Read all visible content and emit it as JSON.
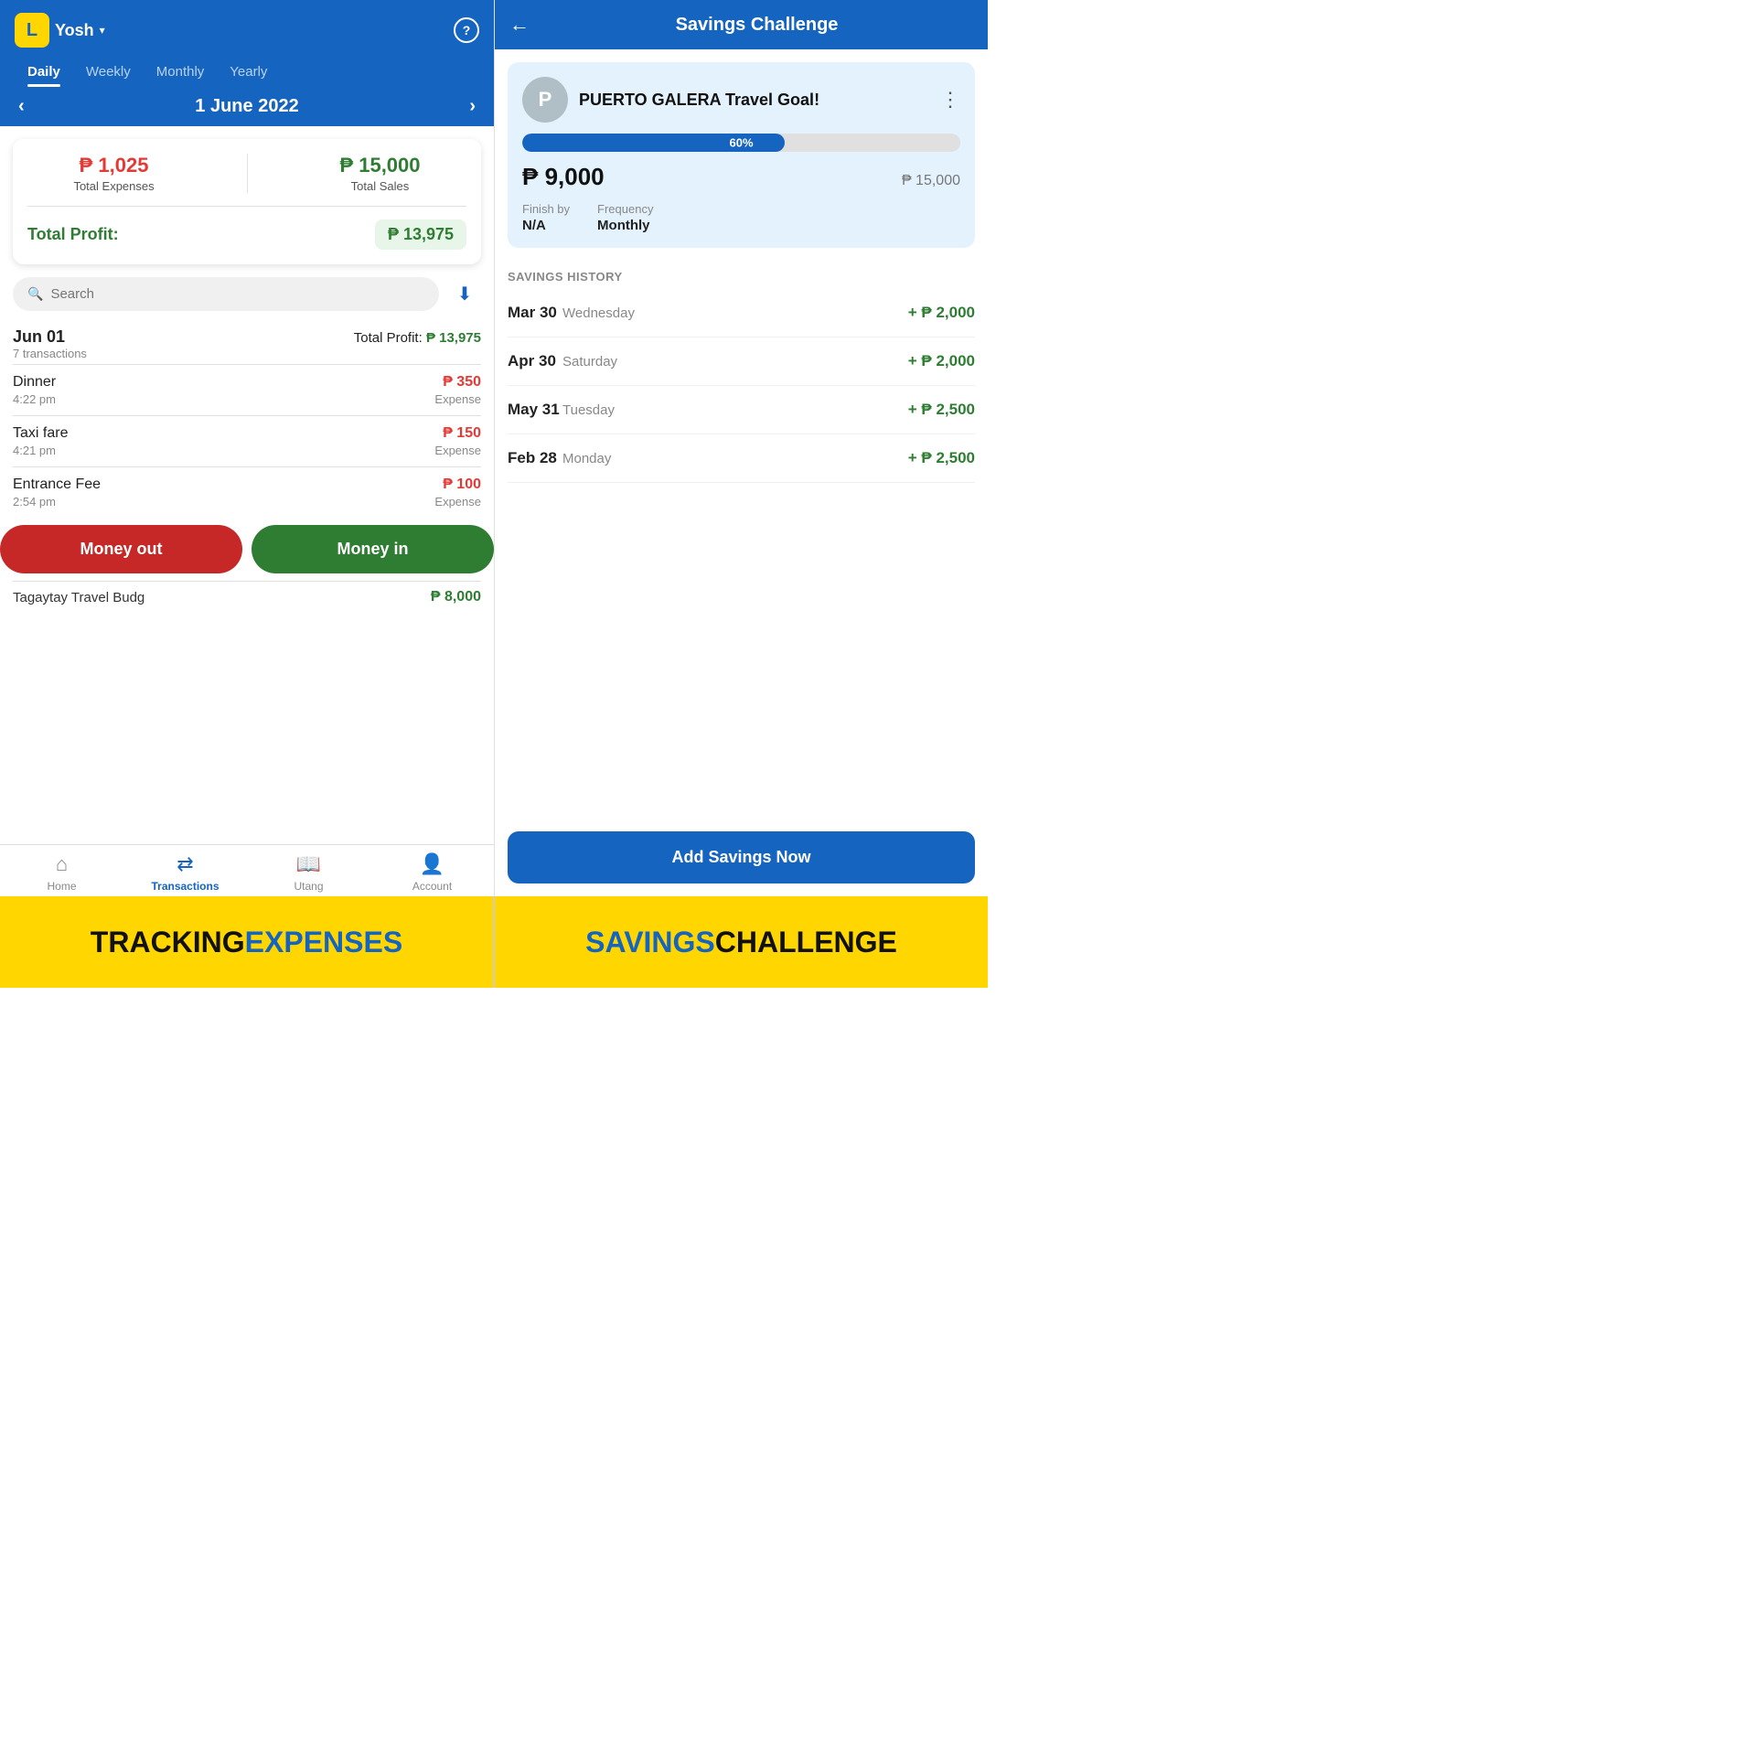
{
  "left": {
    "logo_letter": "L",
    "user_name": "Yosh",
    "help_icon": "?",
    "tabs": [
      {
        "label": "Daily",
        "active": true
      },
      {
        "label": "Weekly",
        "active": false
      },
      {
        "label": "Monthly",
        "active": false
      },
      {
        "label": "Yearly",
        "active": false
      }
    ],
    "date": "1 June 2022",
    "summary": {
      "total_expenses_label": "Total Expenses",
      "total_expenses_amount": "₱ 1,025",
      "total_sales_label": "Total Sales",
      "total_sales_amount": "₱ 15,000",
      "profit_label": "Total Profit:",
      "profit_amount": "₱ 13,975"
    },
    "search_placeholder": "Search",
    "transactions": {
      "group_date": "Jun 01",
      "group_sub": "7 transactions",
      "group_profit_label": "Total Profit:",
      "group_profit_val": "₱ 13,975",
      "items": [
        {
          "name": "Dinner",
          "time": "4:22 pm",
          "amount": "₱ 350",
          "type": "Expense",
          "is_expense": true
        },
        {
          "name": "Taxi fare",
          "time": "4:21 pm",
          "amount": "₱ 150",
          "type": "Expense",
          "is_expense": true
        },
        {
          "name": "Entrance Fee",
          "time": "2:54 pm",
          "amount": "₱ 100",
          "type": "Expense",
          "is_expense": true
        }
      ]
    },
    "partial_tx": {
      "name": "Tagaytay Travel Budg",
      "amount": "₱ 8,000"
    },
    "buttons": {
      "money_out": "Money out",
      "money_in": "Money in"
    },
    "nav": [
      {
        "label": "Home",
        "icon": "⌂",
        "active": false
      },
      {
        "label": "Transactions",
        "icon": "⇄",
        "active": true
      },
      {
        "label": "Utang",
        "icon": "📖",
        "active": false
      },
      {
        "label": "Account",
        "icon": "👤",
        "active": false
      }
    ]
  },
  "right": {
    "back_label": "←",
    "title": "Savings Challenge",
    "goal": {
      "avatar_letter": "P",
      "title": "PUERTO GALERA Travel Goal!",
      "progress_pct": 60,
      "progress_label": "60%",
      "saved_amount": "₱ 9,000",
      "target_amount": "₱ 15,000",
      "finish_by_label": "Finish by",
      "finish_by_val": "N/A",
      "frequency_label": "Frequency",
      "frequency_val": "Monthly"
    },
    "savings_history_label": "SAVINGS HISTORY",
    "history_items": [
      {
        "date": "Mar 30",
        "day": "Wednesday",
        "amount": "+ ₱ 2,000"
      },
      {
        "date": "Apr 30",
        "day": "Saturday",
        "amount": "+ ₱ 2,000"
      },
      {
        "date": "May 31",
        "day": "Tuesday",
        "amount": "+ ₱ 2,500"
      },
      {
        "date": "Feb 28",
        "day": "Monday",
        "amount": "+ ₱ 2,500"
      }
    ],
    "add_savings_btn": "Add Savings Now"
  },
  "banner": {
    "left_part1": "TRACKING ",
    "left_part2": "EXPENSES",
    "right_part1": "SAVINGS",
    "right_part2": " CHALLENGE"
  }
}
